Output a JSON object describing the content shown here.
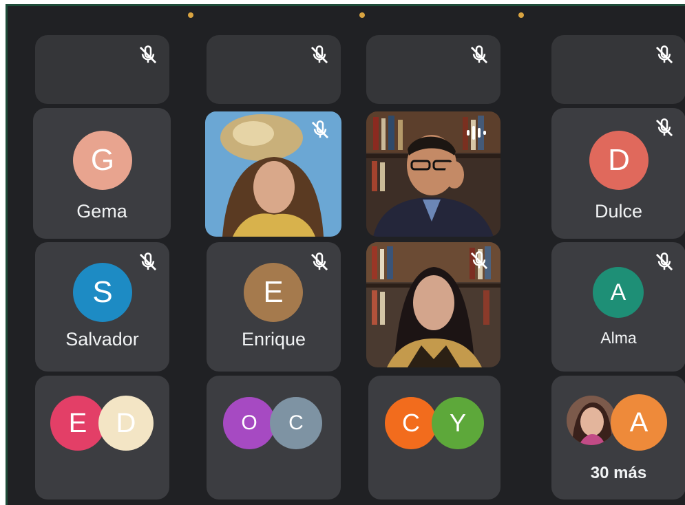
{
  "participants": [
    {
      "name": "Gema",
      "initial": "G",
      "color": "#e8a48f"
    },
    {
      "name": "Dulce",
      "initial": "D",
      "color": "#e0695c"
    },
    {
      "name": "Salvador",
      "initial": "S",
      "color": "#1d8bc4"
    },
    {
      "name": "Enrique",
      "initial": "E",
      "color": "#a57a4d"
    },
    {
      "name": "Alma",
      "initial": "A",
      "color": "#1e8f76"
    }
  ],
  "groups": [
    {
      "initials": [
        "E",
        "D"
      ],
      "colors": [
        "#e33f67",
        "#f3e5c5"
      ]
    },
    {
      "initials": [
        "O",
        "C"
      ],
      "colors": [
        "#a64ac2",
        "#7e93a3"
      ]
    },
    {
      "initials": [
        "C",
        "Y"
      ],
      "colors": [
        "#f26c1d",
        "#5da83a"
      ]
    },
    {
      "initials": [
        "",
        "A"
      ],
      "colors": [
        "#6e4c3f",
        "#ee8a3a"
      ],
      "more_label": "30 más"
    }
  ],
  "icons": {
    "muted": "mic-off-icon",
    "speaking": "audio-level-icon"
  }
}
